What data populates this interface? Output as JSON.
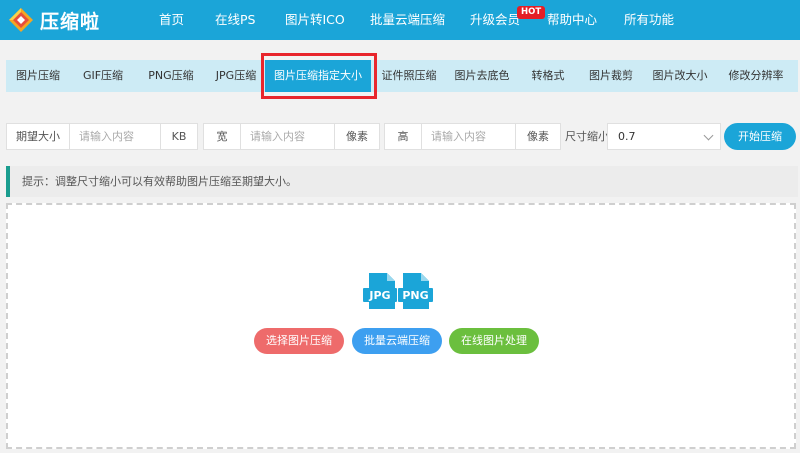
{
  "brand": {
    "name": "压缩啦"
  },
  "nav": {
    "items": [
      "首页",
      "在线PS",
      "图片转ICO",
      "批量云端压缩",
      "升级会员",
      "帮助中心",
      "所有功能"
    ],
    "hot_badge": "HOT"
  },
  "tabs": {
    "items": [
      "图片压缩",
      "GIF压缩",
      "PNG压缩",
      "JPG压缩",
      "图片压缩指定大小",
      "证件照压缩",
      "图片去底色",
      "转格式",
      "图片裁剪",
      "图片改大小",
      "修改分辨率"
    ],
    "active": "图片压缩指定大小"
  },
  "form": {
    "expected_size": {
      "label": "期望大小",
      "placeholder": "请输入内容",
      "unit": "KB"
    },
    "width": {
      "label": "宽",
      "placeholder": "请输入内容",
      "unit": "像素"
    },
    "height": {
      "label": "高",
      "placeholder": "请输入内容",
      "unit": "像素"
    },
    "scale": {
      "label": "尺寸缩小",
      "value": "0.7"
    },
    "start_label": "开始压缩"
  },
  "tip": {
    "text": "提示：调整尺寸缩小可以有效帮助图片压缩至期望大小。"
  },
  "dropzone": {
    "icons": [
      "JPG",
      "PNG"
    ],
    "buttons": {
      "select": "选择图片压缩",
      "batch": "批量云端压缩",
      "online": "在线图片处理"
    }
  },
  "colors": {
    "primary": "#1ba5d8",
    "tab_bg": "#cdebf5",
    "hot": "#e41e26",
    "highlight": "#e8262c",
    "btn_red": "#ee6b6b",
    "btn_blue": "#3d9ff0",
    "btn_green": "#6bbf3e",
    "tip_accent": "#1a9d8f"
  }
}
